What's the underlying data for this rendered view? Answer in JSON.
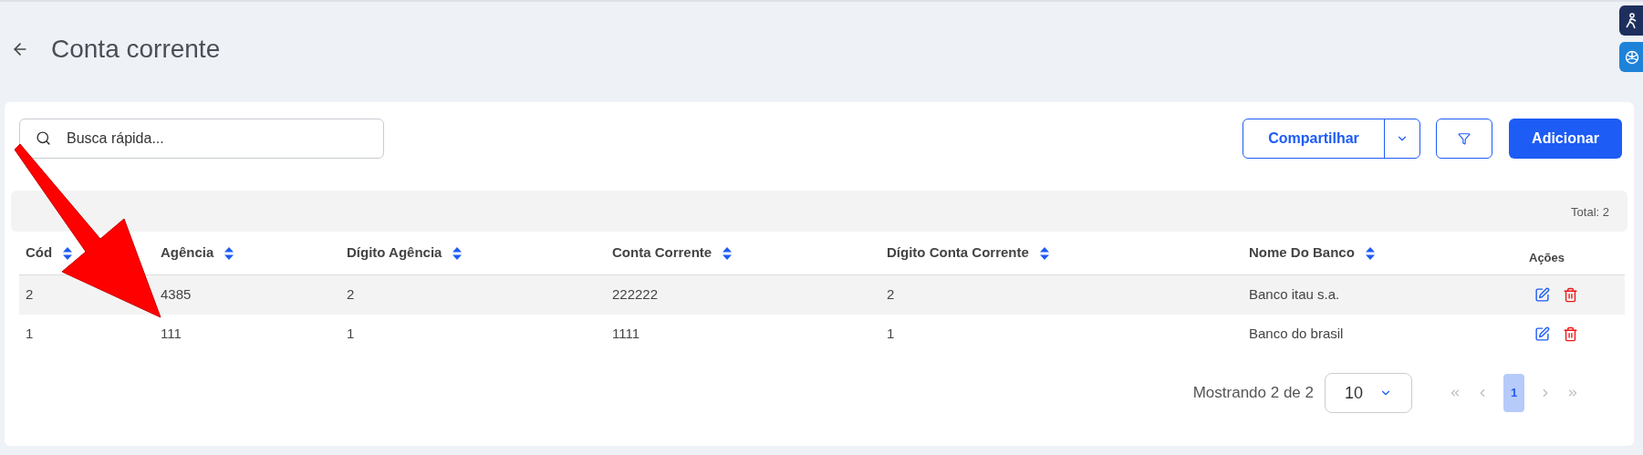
{
  "page": {
    "title": "Conta corrente"
  },
  "toolbar": {
    "search": {
      "placeholder": "Busca rápida..."
    },
    "share_button": "Compartilhar",
    "add_button": "Adicionar"
  },
  "summary": "Total: 2",
  "table": {
    "columns": [
      {
        "label": "Cód",
        "sortable": true
      },
      {
        "label": "Agência",
        "sortable": true
      },
      {
        "label": "Dígito Agência",
        "sortable": true
      },
      {
        "label": "Conta Corrente",
        "sortable": true
      },
      {
        "label": "Dígito Conta Corrente",
        "sortable": true
      },
      {
        "label": "Nome Do Banco",
        "sortable": true
      },
      {
        "label": "Ações",
        "sortable": false
      }
    ],
    "rows": [
      {
        "cells": [
          "2",
          "4385",
          "2",
          "222222",
          "2",
          "Banco itau s.a."
        ]
      },
      {
        "cells": [
          "1",
          "111",
          "1",
          "1111",
          "1",
          "Banco do brasil"
        ]
      }
    ]
  },
  "pagination": {
    "info": "Mostrando 2 de 2",
    "page_size": "10",
    "pages": [
      {
        "label": "1",
        "selected": true
      }
    ]
  }
}
